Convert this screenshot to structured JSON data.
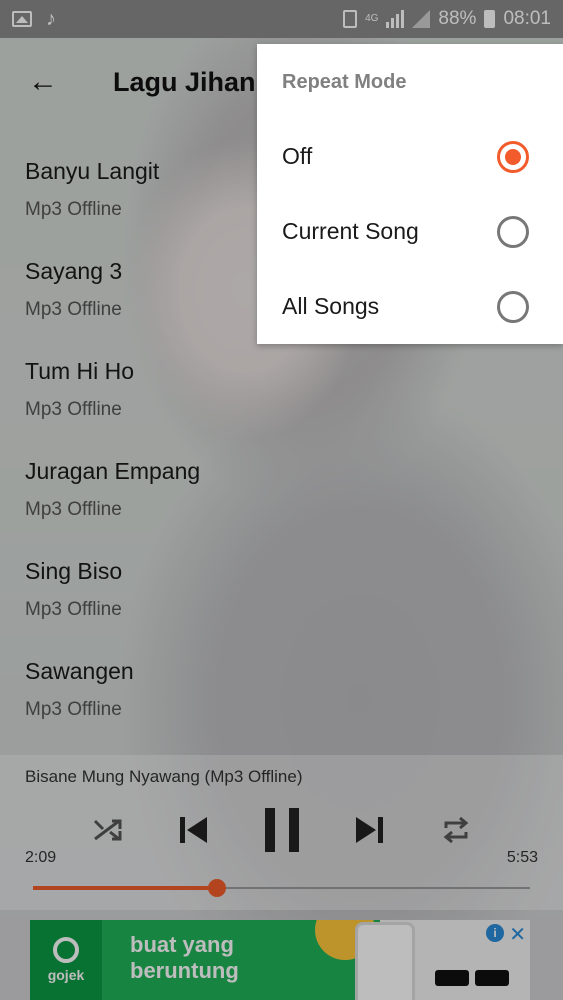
{
  "status_bar": {
    "network": "4G",
    "battery": "88%",
    "time": "08:01",
    "icons": [
      "image-icon",
      "music-note-icon",
      "sim-icon",
      "signal-icon",
      "battery-icon"
    ]
  },
  "app_bar": {
    "title": "Lagu Jihan",
    "back_icon": "back-arrow-icon"
  },
  "songs": [
    {
      "title": "Banyu Langit",
      "subtitle": "Mp3 Offline"
    },
    {
      "title": "Sayang 3",
      "subtitle": "Mp3 Offline"
    },
    {
      "title": "Tum Hi Ho",
      "subtitle": "Mp3 Offline"
    },
    {
      "title": "Juragan Empang",
      "subtitle": "Mp3 Offline"
    },
    {
      "title": "Sing Biso",
      "subtitle": "Mp3 Offline"
    },
    {
      "title": "Sawangen",
      "subtitle": "Mp3 Offline"
    }
  ],
  "player": {
    "now_playing": "Bisane Mung Nyawang (Mp3 Offline)",
    "elapsed": "2:09",
    "duration": "5:53",
    "progress_percent": 37,
    "accent_color": "#f25c2c",
    "controls": [
      "shuffle-icon",
      "previous-icon",
      "pause-icon",
      "next-icon",
      "repeat-icon"
    ]
  },
  "ad": {
    "brand": "gojek",
    "headline_line1": "buat yang",
    "headline_line2": "beruntung"
  },
  "repeat_dialog": {
    "title": "Repeat Mode",
    "options": [
      {
        "label": "Off",
        "selected": true
      },
      {
        "label": "Current Song",
        "selected": false
      },
      {
        "label": "All Songs",
        "selected": false
      }
    ]
  }
}
